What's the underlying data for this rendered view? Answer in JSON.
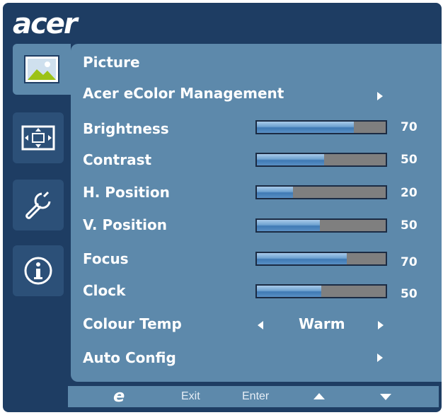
{
  "brand": "acer",
  "tabs": [
    {
      "icon": "picture-icon",
      "active": true
    },
    {
      "icon": "position-icon",
      "active": false
    },
    {
      "icon": "settings-wrench-icon",
      "active": false
    },
    {
      "icon": "info-icon",
      "active": false
    }
  ],
  "menu": {
    "title": "Picture",
    "ecolor": {
      "label": "Acer eColor Management",
      "icon": "arrow-right-icon"
    },
    "brightness": {
      "label": "Brightness",
      "value": 70,
      "fill_fraction": 0.75
    },
    "contrast": {
      "label": "Contrast",
      "value": 50,
      "fill_fraction": 0.52
    },
    "hposition": {
      "label": "H. Position",
      "value": 20,
      "fill_fraction": 0.28
    },
    "vposition": {
      "label": "V. Position",
      "value": 50,
      "fill_fraction": 0.49
    },
    "focus": {
      "label": "Focus",
      "value": 70,
      "fill_fraction": 0.7
    },
    "clock": {
      "label": "Clock",
      "value": 50,
      "fill_fraction": 0.5
    },
    "colour_temp": {
      "label": "Colour Temp",
      "value": "Warm"
    },
    "auto_config": {
      "label": "Auto Config",
      "icon": "arrow-right-icon"
    }
  },
  "footer": {
    "logo": "e",
    "exit": "Exit",
    "enter": "Enter",
    "up_icon": "triangle-up-icon",
    "down_icon": "triangle-down-icon"
  },
  "colors": {
    "frame": "#1e3d63",
    "panel": "#5d89ab",
    "slider_fill": "#6ea2d0",
    "slider_track": "#7f7f7f"
  }
}
